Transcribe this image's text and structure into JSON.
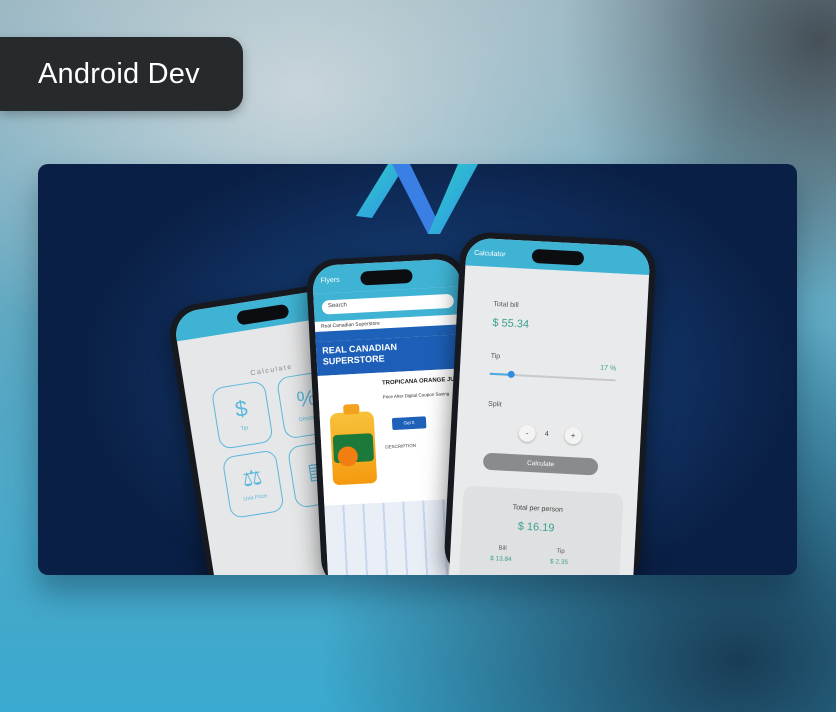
{
  "badge": {
    "label": "Android Dev"
  },
  "colors": {
    "accent": "#3fb3d4",
    "badge_bg": "#262a2d",
    "card_bg": "#123466",
    "result_teal": "#3aa08f"
  },
  "phones": {
    "left": {
      "title": "Calculate",
      "tiles": [
        {
          "icon": "dollar-icon",
          "glyph": "$",
          "label": "Tip"
        },
        {
          "icon": "percent-icon",
          "glyph": "%",
          "label": "Discount"
        },
        {
          "icon": "scale-icon",
          "glyph": "⚖",
          "label": "Unit Price"
        },
        {
          "icon": "receipt-icon",
          "glyph": "▤",
          "label": ""
        }
      ]
    },
    "middle": {
      "topbar": "Flyers",
      "search": "Search",
      "strip": "Real Canadian Superstore",
      "banner_line1": "REAL CANADIAN",
      "banner_line2": "SUPERSTORE",
      "product_title": "TROPICANA ORANGE JUICE",
      "product_sub": "Price After Digital Coupon Saving",
      "button": "Get It",
      "description_label": "DESCRIPTION"
    },
    "right": {
      "topbar": "Calculator",
      "total_bill_label": "Total bill",
      "total_bill_value": "$ 55.34",
      "tip_label": "Tip",
      "tip_value": "17 %",
      "tip_level": 0.17,
      "split_label": "Split",
      "split_value": "4",
      "minus": "-",
      "plus": "+",
      "calculate": "Calculate",
      "total_per_person_label": "Total per person",
      "total_per_person_value": "$ 16.19",
      "bill_label": "Bill",
      "bill_value": "$ 13.84",
      "tip_result_label": "Tip",
      "tip_result_value": "$ 2.35"
    }
  }
}
